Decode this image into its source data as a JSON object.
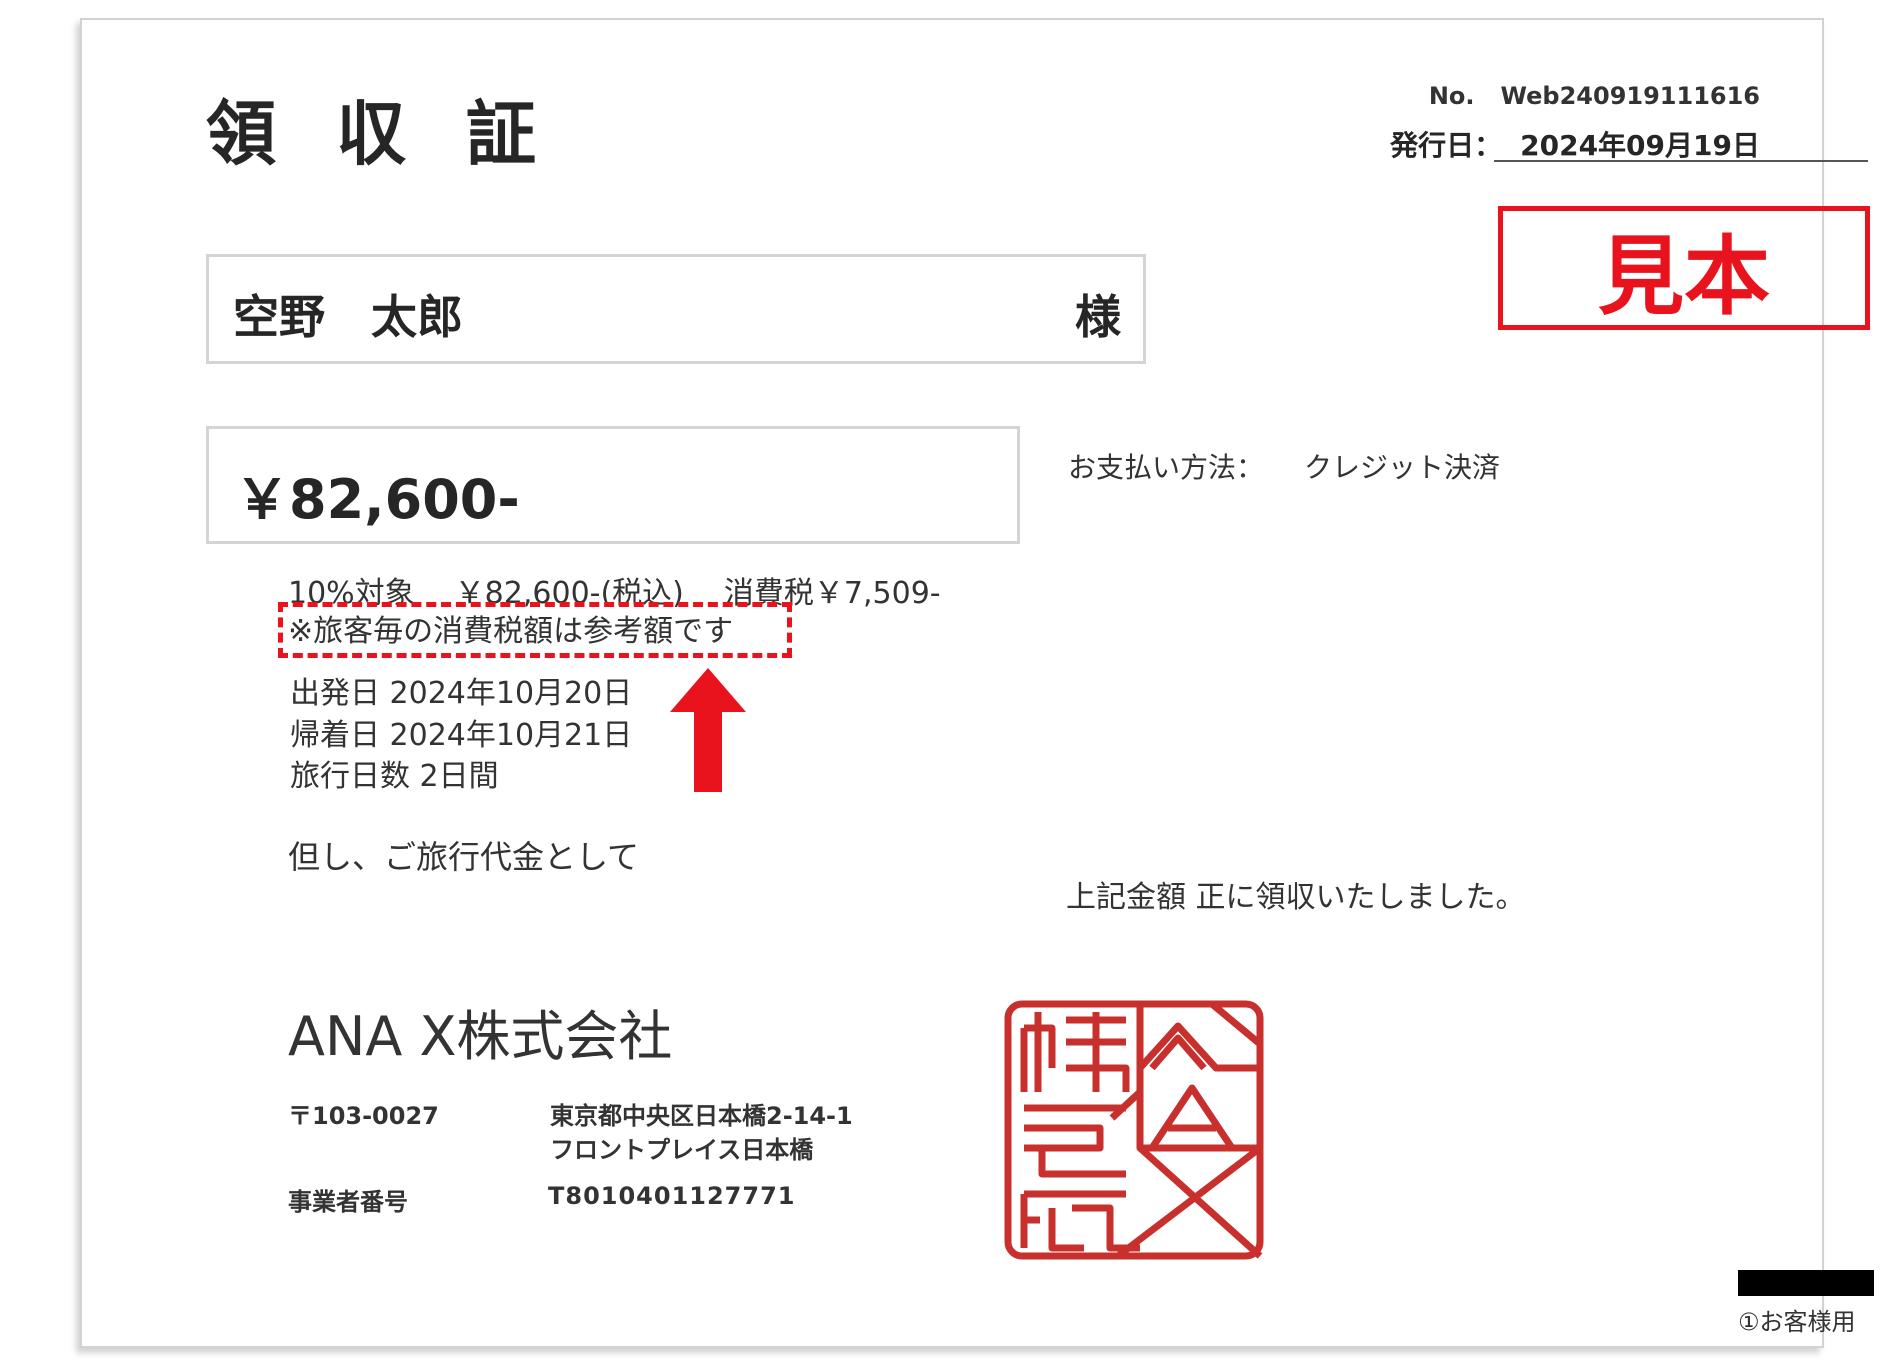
{
  "receipt": {
    "title": "領収証",
    "number_label": "No.",
    "number_value": "Web240919111616",
    "issue_label": "発行日：",
    "issue_value": "2024年09月19日",
    "sample_stamp": "見本",
    "recipient_name": "空野　太郎",
    "recipient_honorific": "様",
    "amount": "￥82,600-",
    "payment_label": "お支払い方法：",
    "payment_value": "クレジット決済",
    "tax_rate": "10%対象",
    "tax_included": "￥82,600-(税込)",
    "tax_amount": "消費税￥7,509-",
    "tax_note": "※旅客毎の消費税額は参考額です",
    "departure": "出発日 2024年10月20日",
    "return": "帰着日 2024年10月21日",
    "days": "旅行日数 2日間",
    "however": "但し、ご旅行代金として",
    "received": "上記金額 正に領収いたしました。",
    "copy_label": "①お客様用"
  },
  "issuer": {
    "company": "ANA X株式会社",
    "zip": "〒103-0027",
    "address_line1": "東京都中央区日本橋2-14-1",
    "address_line2": "フロントプレイス日本橋",
    "business_number_label": "事業者番号",
    "business_number": "T8010401127771",
    "seal_text": "ANA X株式会社"
  },
  "colors": {
    "accent_red": "#e8131d",
    "seal_red": "#c8302e",
    "border_gray": "#d4d4d4"
  },
  "icons": {
    "arrow": "arrow-up-icon"
  }
}
